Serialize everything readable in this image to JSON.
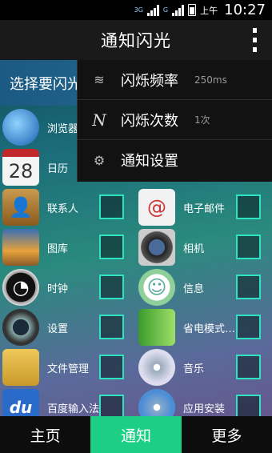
{
  "status": {
    "net_top": "3G",
    "net_bottom": "G",
    "ampm": "上午",
    "time": "10:27"
  },
  "title": "通知闪光",
  "select_header": "选择要闪光",
  "menu": [
    {
      "icon": "wave-icon",
      "label": "闪烁频率",
      "value": "250ms"
    },
    {
      "icon": "letter-n-icon",
      "label": "闪烁次数",
      "value": "1次"
    },
    {
      "icon": "gear-icon",
      "label": "通知设置",
      "value": ""
    }
  ],
  "apps": [
    {
      "left": {
        "label": "浏览器",
        "icon": "globe-icon"
      },
      "right": {
        "label": "",
        "icon": ""
      }
    },
    {
      "left": {
        "label": "日历",
        "icon": "calendar-icon",
        "badge": "28"
      },
      "right": {
        "label": "",
        "icon": ""
      }
    },
    {
      "left": {
        "label": "联系人",
        "icon": "contacts-icon"
      },
      "right": {
        "label": "电子邮件",
        "icon": "email-icon"
      }
    },
    {
      "left": {
        "label": "图库",
        "icon": "gallery-icon"
      },
      "right": {
        "label": "相机",
        "icon": "camera-icon"
      }
    },
    {
      "left": {
        "label": "时钟",
        "icon": "clock-icon"
      },
      "right": {
        "label": "信息",
        "icon": "message-icon"
      }
    },
    {
      "left": {
        "label": "设置",
        "icon": "settings-icon"
      },
      "right": {
        "label": "省电模式…",
        "icon": "battery-saver-icon"
      }
    },
    {
      "left": {
        "label": "文件管理",
        "icon": "folder-icon"
      },
      "right": {
        "label": "音乐",
        "icon": "music-icon"
      }
    },
    {
      "left": {
        "label": "百度输入法",
        "icon": "baidu-ime-icon",
        "badge": "du"
      },
      "right": {
        "label": "应用安装",
        "icon": "package-installer-icon"
      }
    }
  ],
  "nav": [
    {
      "label": "主页",
      "active": false
    },
    {
      "label": "通知",
      "active": true
    },
    {
      "label": "更多",
      "active": false
    }
  ]
}
